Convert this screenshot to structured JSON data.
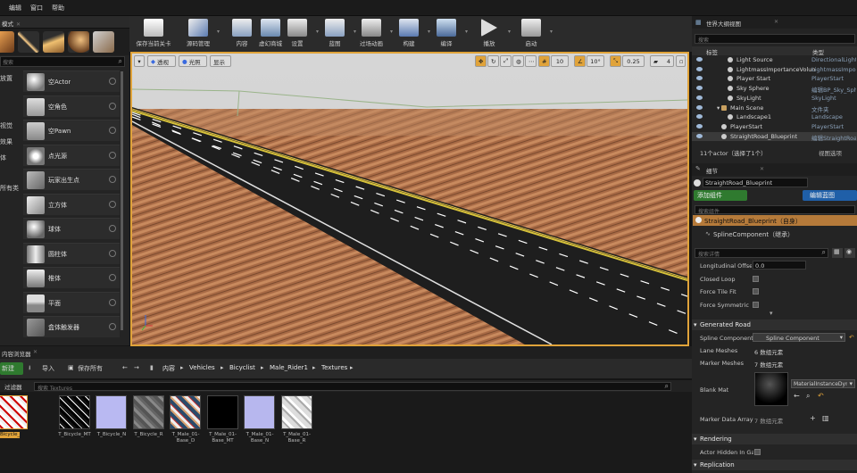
{
  "menu": {
    "items": [
      "编辑",
      "窗口",
      "帮助"
    ],
    "left_tab": "模式"
  },
  "toolbar": {
    "buttons": [
      {
        "label": "保存当前关卡"
      },
      {
        "label": "源码管理"
      },
      {
        "label": "内容"
      },
      {
        "label": "虚幻商城"
      },
      {
        "label": "设置"
      },
      {
        "label": "蓝图"
      },
      {
        "label": "过场动画"
      },
      {
        "label": "构建"
      },
      {
        "label": "编译"
      },
      {
        "label": "播放"
      },
      {
        "label": "启动"
      }
    ]
  },
  "modes": {
    "search_placeholder": "搜索",
    "categories": [
      "放置",
      "",
      "",
      "",
      "",
      "视觉",
      "效果",
      "",
      "体",
      "",
      "",
      "",
      "",
      "所有类"
    ],
    "category_labels": [
      "放置",
      "视觉",
      "效果",
      "体",
      "所有类"
    ],
    "items": [
      "空Actor",
      "空角色",
      "空Pawn",
      "点光源",
      "玩家出生点",
      "立方体",
      "球体",
      "圆柱体",
      "椎体",
      "平面",
      "盒体触发器"
    ]
  },
  "viewport": {
    "perspective": "透视",
    "lit": "光照",
    "show": "显示",
    "grid_value": "10",
    "angle_value": "10°",
    "scale_value": "0.25",
    "camera_speed": "4"
  },
  "outliner": {
    "tab": "世界大纲视图",
    "search_placeholder": "搜索",
    "col_label": "标签",
    "col_type": "类型",
    "rows": [
      {
        "name": "Light Source",
        "type": "DirectionalLight",
        "indent": 50
      },
      {
        "name": "LightmassImportanceVolume",
        "type": "LightmassImportanceVolume",
        "indent": 50
      },
      {
        "name": "Player Start",
        "type": "PlayerStart",
        "indent": 50
      },
      {
        "name": "Sky Sphere",
        "type": "编辑BP_Sky_Sphere",
        "indent": 50
      },
      {
        "name": "SkyLight",
        "type": "SkyLight",
        "indent": 50
      },
      {
        "name": "Main Scene",
        "type": "文件夹",
        "indent": 43
      },
      {
        "name": "Landscape1",
        "type": "Landscape",
        "indent": 50
      },
      {
        "name": "PlayerStart",
        "type": "PlayerStart",
        "indent": 43
      },
      {
        "name": "StraightRoad_Blueprint",
        "type": "编辑StraightRoad",
        "indent": 43
      }
    ],
    "footer": "11个actor（选择了1个）",
    "view_options": "视图选项"
  },
  "details": {
    "tab": "细节",
    "object_name": "StraightRoad_Blueprint",
    "add_component": "添加组件",
    "edit_blueprint": "编辑蓝图",
    "search_components": "搜索组件",
    "self_row": "StraightRoad_Blueprint（自身）",
    "spline_row": "SplineComponent（继承）",
    "search_details": "搜索详情",
    "props": [
      {
        "label": "Longitudinal Offset",
        "value": "0.0"
      },
      {
        "label": "Closed Loop",
        "value": ""
      },
      {
        "label": "Force Tile Fit",
        "value": ""
      },
      {
        "label": "Force Symmetric",
        "value": ""
      }
    ],
    "section_generated": "Generated Road",
    "spline_label": "Spline Component",
    "spline_value": "Spline Component",
    "lane_label": "Lane Meshes",
    "lane_value": "6 数组元素",
    "marker_label": "Marker Meshes",
    "marker_value": "7 数组元素",
    "blank_label": "Blank Mat",
    "blank_value": "MaterialInstanceDynamic",
    "marker_data_label": "Marker Data Array",
    "marker_data_value": "7 数组元素",
    "section_render": "Rendering",
    "actor_hidden": "Actor Hidden In Game",
    "section_repl": "Replication"
  },
  "content": {
    "tab": "内容浏览器",
    "add_new": "新建",
    "import": "导入",
    "save_all": "保存所有",
    "path": [
      "内容",
      "Vehicles",
      "Bicyclist",
      "Male_Rider1",
      "Textures"
    ],
    "filters": "过滤器",
    "search_placeholder": "搜索 Textures",
    "assets": [
      "Bicycle_D",
      "T_Bicycle_MT",
      "T_Bicycle_N",
      "T_Bicycle_R",
      "T_Male_01-Base_D",
      "T_Male_01-Base_MT",
      "T_Male_01-Base_N",
      "T_Male_01-Base_R"
    ]
  },
  "colors": {
    "selection": "#e0a33a",
    "accent_green": "#2f7a2f",
    "accent_blue": "#1f5fa8"
  }
}
